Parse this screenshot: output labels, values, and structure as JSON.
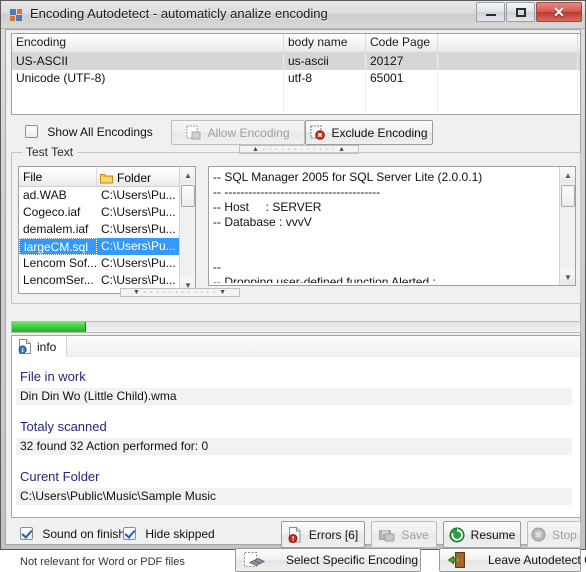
{
  "window": {
    "title": "Encoding Autodetect - automaticly analize encoding",
    "icon": "app-icon",
    "buttons": {
      "minimize": "minimize-button",
      "maximize": "maximize-button",
      "close_glyph": "✕"
    }
  },
  "encoding_grid": {
    "columns": [
      "Encoding",
      "body name",
      "Code Page",
      ""
    ],
    "rows": [
      {
        "encoding": "US-ASCII",
        "body_name": "us-ascii",
        "code_page": "20127",
        "selected": true
      },
      {
        "encoding": "Unicode (UTF-8)",
        "body_name": "utf-8",
        "code_page": "65001",
        "selected": false
      }
    ]
  },
  "actions": {
    "show_all_encodings": {
      "label": "Show All Encodings",
      "checked": false
    },
    "allow_encoding": {
      "label": "Allow Encoding",
      "enabled": false
    },
    "exclude_encoding": {
      "label": "Exclude Encoding",
      "enabled": true
    }
  },
  "test_text": {
    "group_label": "Test Text",
    "file_list": {
      "columns": [
        "File",
        "Folder"
      ],
      "folder_icon": "folder-icon",
      "rows": [
        {
          "file": "ad.WAB",
          "folder": "C:\\Users\\Pu...",
          "selected": false
        },
        {
          "file": "Cogeco.iaf",
          "folder": "C:\\Users\\Pu...",
          "selected": false
        },
        {
          "file": "demalem.iaf",
          "folder": "C:\\Users\\Pu...",
          "selected": false
        },
        {
          "file": "largeCM.sql",
          "folder": "C:\\Users\\Pu...",
          "selected": true
        },
        {
          "file": "Lencom Sof...",
          "folder": "C:\\Users\\Pu...",
          "selected": false
        },
        {
          "file": "LencomSer...",
          "folder": "C:\\Users\\Pu...",
          "selected": false
        }
      ]
    },
    "preview_text": "-- SQL Manager 2005 for SQL Server Lite (2.0.0.1)\n-- ---------------------------------------\n-- Host     : SERVER\n-- Database : vvvV\n\n\n--\n-- Dropping user-defined function Alerted :"
  },
  "progress": {
    "percent": 13
  },
  "info_panel": {
    "tab_label": "info",
    "tab_icon": "info-document-icon",
    "sections": [
      {
        "heading": "File in work",
        "value": "Din Din Wo (Little Child).wma"
      },
      {
        "heading": "Totaly scanned",
        "value": "32  found 32 Action performed for: 0"
      },
      {
        "heading": "Curent Folder",
        "value": "C:\\Users\\Public\\Music\\Sample Music"
      }
    ]
  },
  "bottom": {
    "sound_on_finish": {
      "label": "Sound on finish",
      "checked": true
    },
    "hide_skipped": {
      "label": "Hide skipped",
      "checked": true
    },
    "errors": {
      "label": "Errors [6]",
      "enabled": true
    },
    "save": {
      "label": "Save",
      "enabled": false
    },
    "resume": {
      "label": "Resume",
      "enabled": true
    },
    "stop": {
      "label": "Stop",
      "enabled": false
    },
    "hint": "Not relevant for Word or PDF files",
    "select_specific_encoding": {
      "label": "Select Specific Encoding",
      "enabled": true
    },
    "leave_autodetect_on": {
      "label": "Leave Autodetect On",
      "enabled": true
    }
  },
  "colors": {
    "selection": "#3399ff",
    "heading": "#26267a",
    "progress": "#19b319",
    "error": "#c42b1c"
  }
}
